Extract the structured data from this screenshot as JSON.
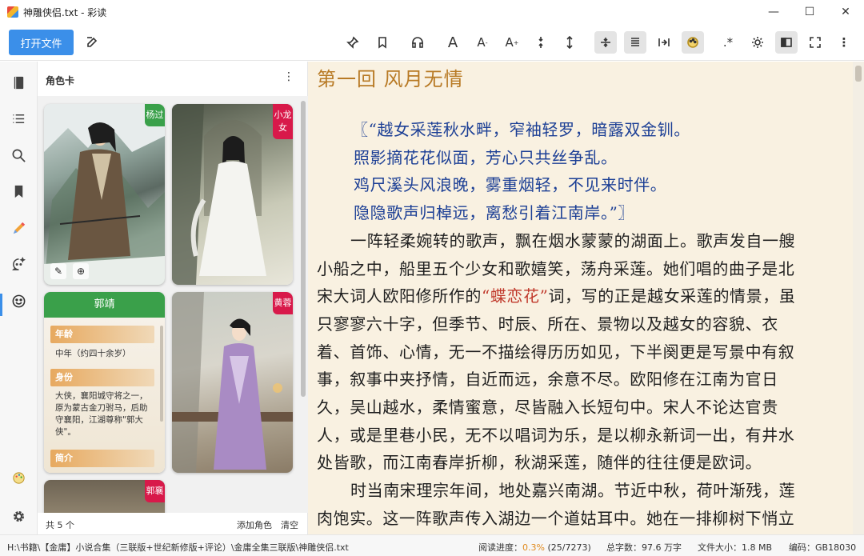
{
  "window": {
    "title": "神雕侠侣.txt - 彩读",
    "minimize": "—",
    "maximize": "☐",
    "close": "✕"
  },
  "toolbar": {
    "open_file": "打开文件"
  },
  "panel": {
    "title": "角色卡",
    "count": "共 5 个",
    "add_role": "添加角色",
    "clear": "清空"
  },
  "characters": [
    {
      "name": "杨过",
      "color": "#3aa04a"
    },
    {
      "name": "小龙女",
      "color": "#d8194a"
    },
    {
      "name": "郭靖",
      "color": "#3aa04a",
      "sections": [
        {
          "label": "年龄",
          "text": "中年（约四十余岁）"
        },
        {
          "label": "身份",
          "text": "大侠，襄阳城守将之一，原为蒙古金刀驸马，后助守襄阳，江湖尊称\"郭大侠\"。"
        },
        {
          "label": "简介",
          "text": ""
        }
      ]
    },
    {
      "name": "黄蓉",
      "color": "#d8194a"
    },
    {
      "name": "郭襄",
      "color": "#d8194a"
    }
  ],
  "reader": {
    "chapter_title": "第一回  风月无情",
    "poem": [
      "〖“越女采莲秋水畔，窄袖轻罗，暗露双金钏。",
      "照影摘花花似面，芳心只共丝争乱。",
      "鸡尺溪头风浪晚，雾重烟轻，不见来时伴。",
      "隐隐歌声归棹远，离愁引着江南岸。”〗"
    ],
    "highlight": "“蝶恋花”",
    "lines": [
      "一阵轻柔婉转的歌声，飘在烟水蒙蒙的湖面上。歌声发自一艘",
      "小船之中，船里五个少女和歌嬉笑，荡舟采莲。她们唱的曲子是北",
      "宋大词人欧阳修所作的",
      "词，写的正是越女采莲的情景，虽",
      "只寥寥六十字，但季节、时辰、所在、景物以及越女的容貌、衣",
      "着、首饰、心情，无一不描绘得历历如见，下半阕更是写景中有叙",
      "事，叙事中夹抒情，自近而远，余意不尽。欧阳修在江南为官日",
      "久，吴山越水，柔情蜜意，尽皆融入长短句中。宋人不论达官贵",
      "人，或是里巷小民，无不以唱词为乐，是以柳永新词一出，有井水",
      "处皆歌，而江南春岸折柳，秋湖采莲，随伴的往往便是欧词。",
      "时当南宋理宗年间，地处嘉兴南湖。节近中秋，荷叶渐残，莲",
      "肉饱实。这一阵歌声传入湖边一个道姑耳中。她在一排柳树下悄立"
    ]
  },
  "status": {
    "path": "H:\\书籍\\【金庸】小说合集（三联版+世纪新修版+评论）\\金庸全集三联版\\神雕侠侣.txt",
    "progress_label": "阅读进度：",
    "progress_pct": "0.3%",
    "progress_detail": "(25/7273)",
    "progress_value": 0.003,
    "word_count": "总字数：97.6 万字",
    "file_size": "文件大小：1.8 MB",
    "encoding": "编码：GB18030"
  },
  "colors": {
    "accent": "#3b8fe9",
    "chapter": "#b87a25",
    "poem": "#1c3f95",
    "highlight": "#c0392b",
    "reader_bg": "#f9f1e1"
  }
}
